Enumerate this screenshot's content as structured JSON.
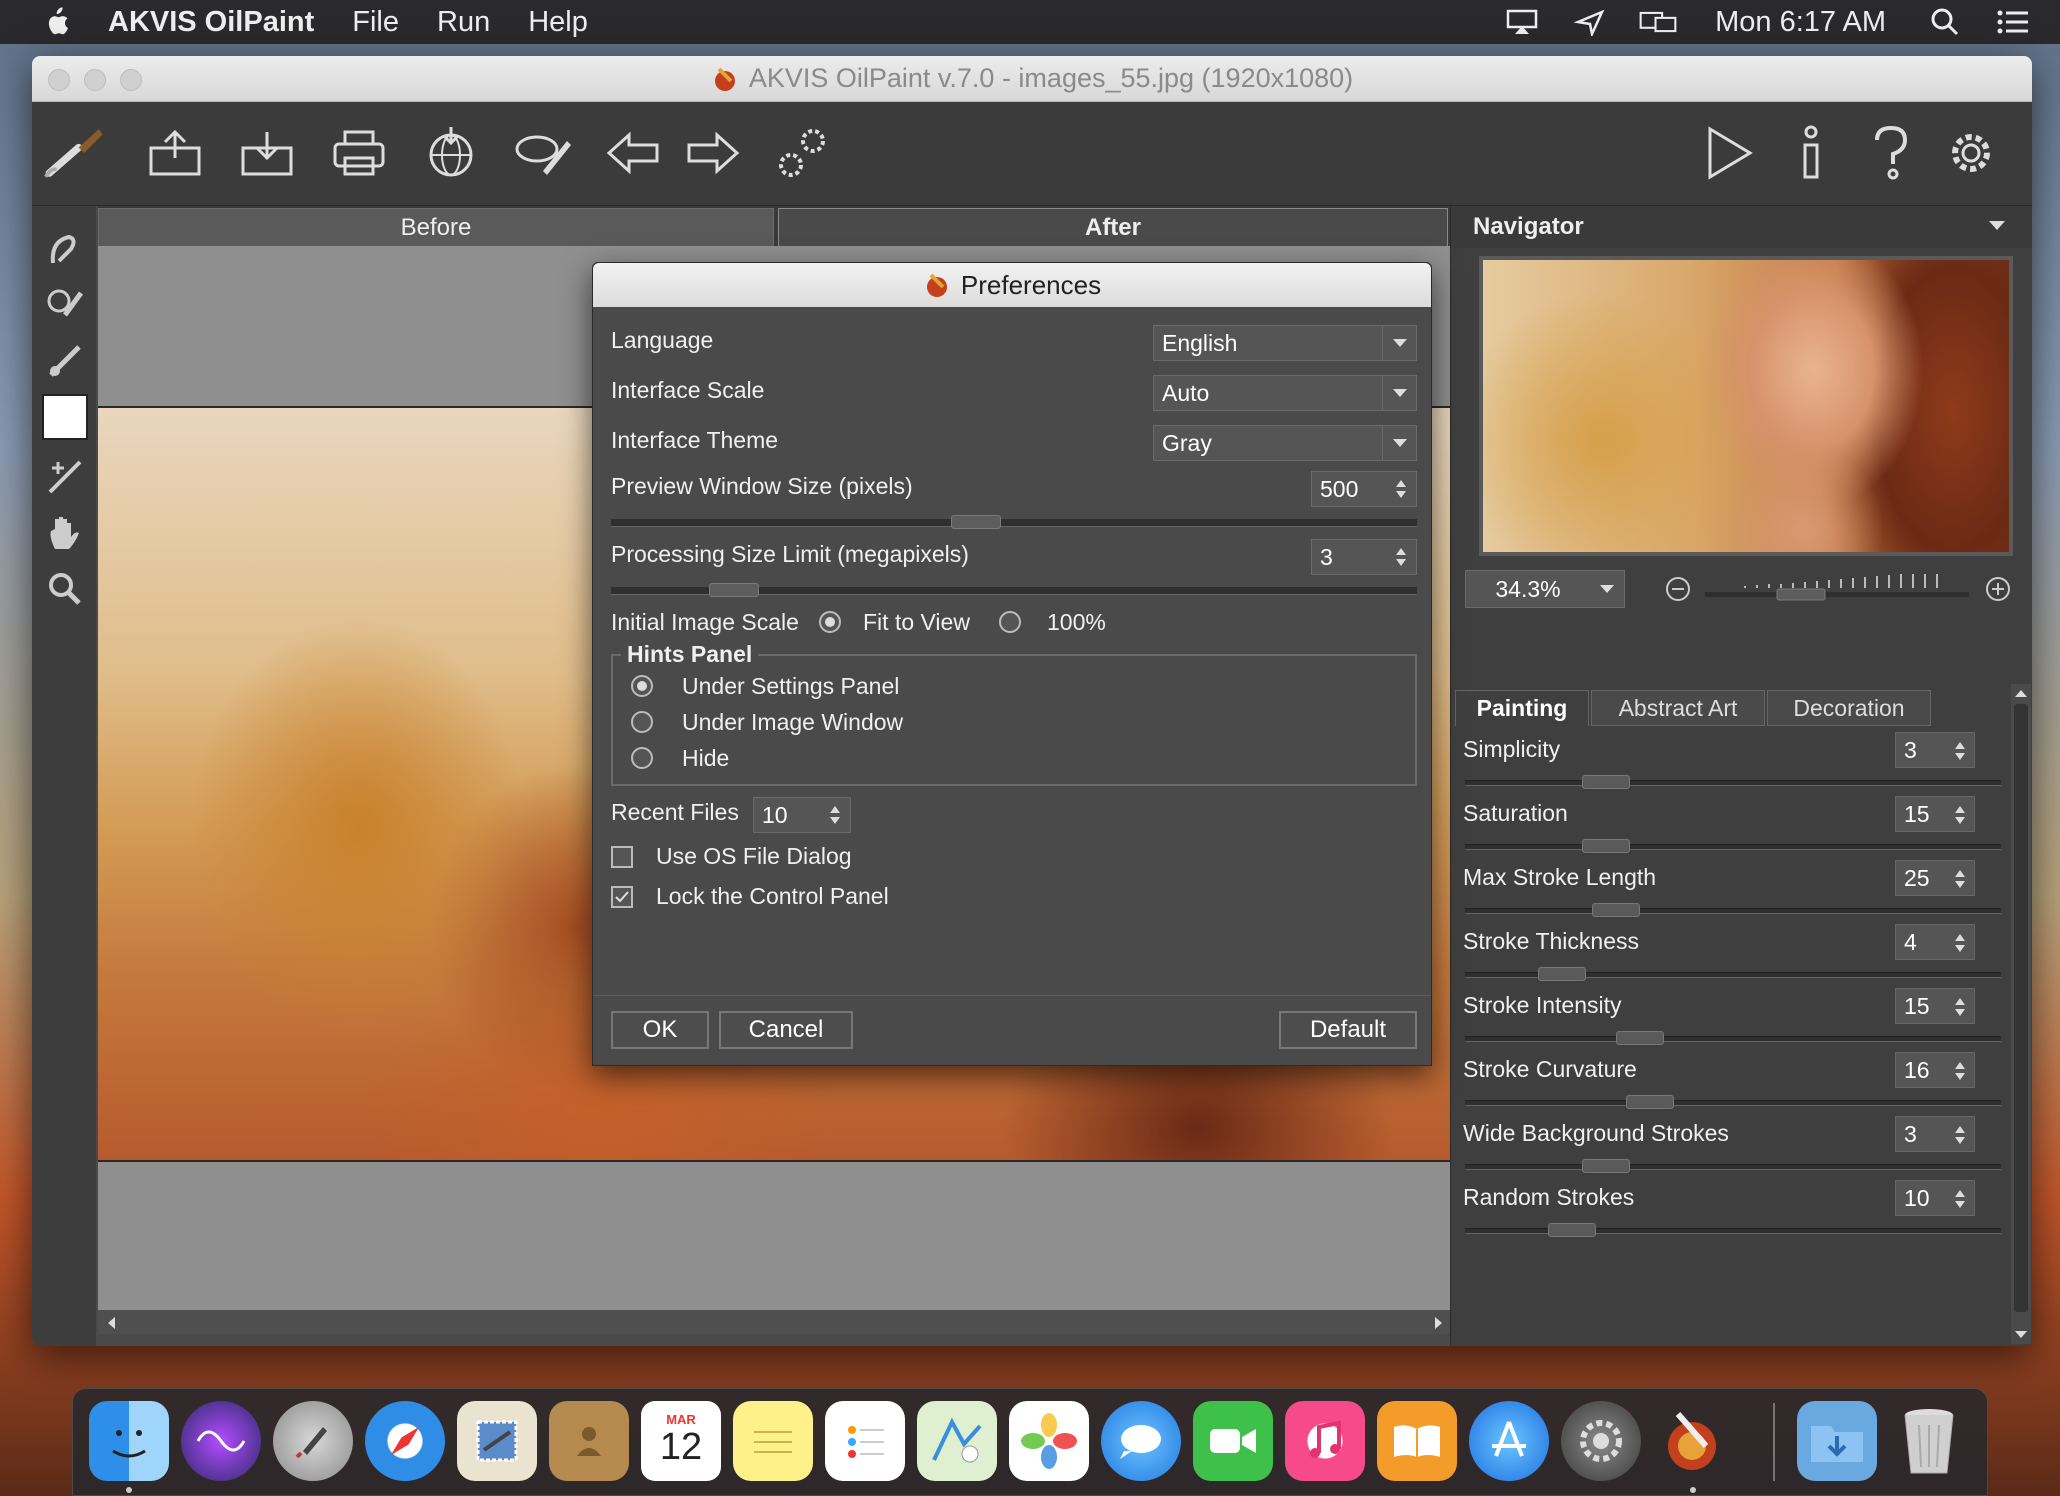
{
  "menubar": {
    "app_name": "AKVIS OilPaint",
    "menus": [
      "File",
      "Run",
      "Help"
    ],
    "clock": "Mon 6:17 AM"
  },
  "window": {
    "title": "AKVIS OilPaint v.7.0 - images_55.jpg (1920x1080)"
  },
  "image_tabs": {
    "before": "Before",
    "after": "After"
  },
  "navigator": {
    "title": "Navigator",
    "zoom": "34.3%"
  },
  "settings": {
    "tabs": [
      "Painting",
      "Abstract Art",
      "Decoration"
    ],
    "params": [
      {
        "label": "Simplicity",
        "value": "3",
        "level": 0.24
      },
      {
        "label": "Saturation",
        "value": "15",
        "level": 0.24
      },
      {
        "label": "Max Stroke Length",
        "value": "25",
        "level": 0.26
      },
      {
        "label": "Stroke Thickness",
        "value": "4",
        "level": 0.15
      },
      {
        "label": "Stroke Intensity",
        "value": "15",
        "level": 0.31
      },
      {
        "label": "Stroke Curvature",
        "value": "16",
        "level": 0.33
      },
      {
        "label": "Wide Background Strokes",
        "value": "3",
        "level": 0.24
      },
      {
        "label": "Random Strokes",
        "value": "10",
        "level": 0.17
      }
    ]
  },
  "preferences": {
    "title": "Preferences",
    "language_label": "Language",
    "language_value": "English",
    "scale_label": "Interface Scale",
    "scale_value": "Auto",
    "theme_label": "Interface Theme",
    "theme_value": "Gray",
    "preview_label": "Preview Window Size (pixels)",
    "preview_value": "500",
    "preview_level": 0.45,
    "limit_label": "Processing Size Limit (megapixels)",
    "limit_value": "3",
    "limit_level": 0.13,
    "initial_scale_label": "Initial Image Scale",
    "fit_to_view": "Fit to View",
    "hundred": "100%",
    "hints_title": "Hints Panel",
    "hints_options": [
      "Under Settings Panel",
      "Under Image Window",
      "Hide"
    ],
    "recent_label": "Recent Files",
    "recent_value": "10",
    "use_os_dialog": "Use OS File Dialog",
    "lock_panel": "Lock the Control Panel",
    "ok": "OK",
    "cancel": "Cancel",
    "default": "Default"
  },
  "dock": {
    "calendar_month": "MAR",
    "calendar_day": "12"
  },
  "colors": {
    "panel_bg": "#4a4a4a",
    "menubar_bg": "#2a2a2c"
  }
}
